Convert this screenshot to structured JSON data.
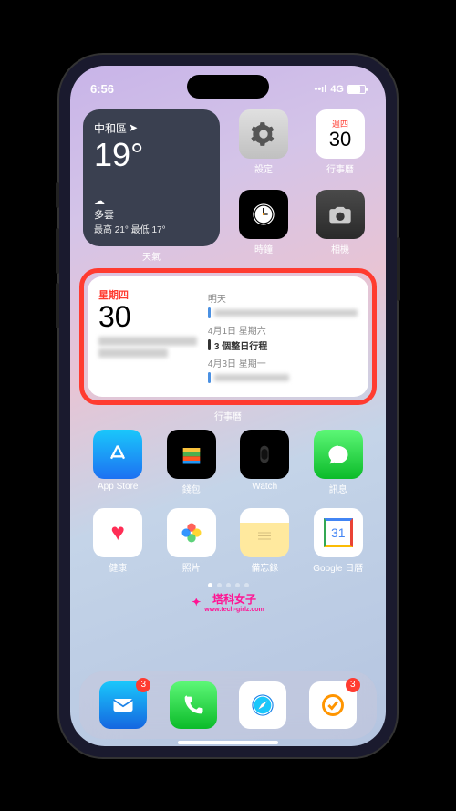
{
  "status": {
    "time": "6:56",
    "network": "4G"
  },
  "weather": {
    "location": "中和區",
    "temp": "19°",
    "condition": "多雲",
    "range": "最高 21° 最低 17°",
    "label": "天氣"
  },
  "topApps": {
    "settings": "設定",
    "calendar": {
      "day": "週四",
      "num": "30",
      "label": "行事曆"
    },
    "clock": "時鐘",
    "camera": "相機"
  },
  "calWidget": {
    "weekday": "星期四",
    "num": "30",
    "tomorrow": "明天",
    "sat": "4月1日 星期六",
    "satEvent": "3 個整日行程",
    "mon": "4月3日 星期一",
    "label": "行事曆"
  },
  "grid": {
    "appstore": "App Store",
    "wallet": "錢包",
    "watch": "Watch",
    "messages": "訊息",
    "health": "健康",
    "photos": "照片",
    "notes": "備忘錄",
    "gcal": "Google 日曆",
    "gcalNum": "31"
  },
  "watermark": {
    "brand": "塔科女子",
    "url": "www.tech-girlz.com"
  },
  "dock": {
    "mailBadge": "3",
    "todoBadge": "3"
  }
}
